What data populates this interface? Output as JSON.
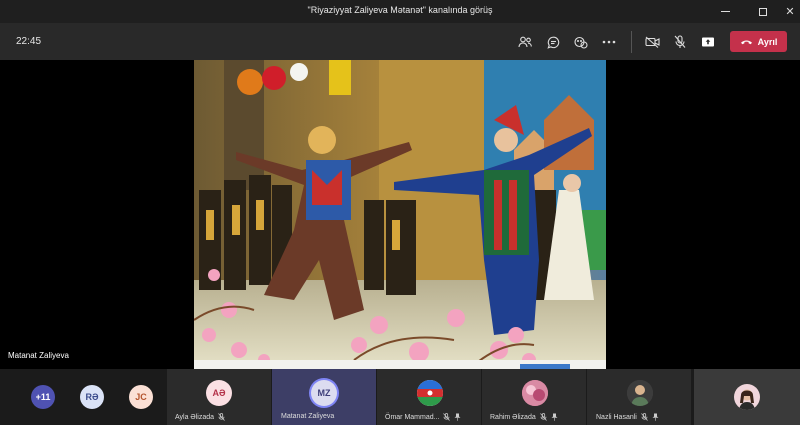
{
  "window": {
    "title": "\"Riyaziyyat Zaliyeva Mətanət\" kanalında görüş"
  },
  "toolbar": {
    "time": "22:45",
    "leave_label": "Ayrıl",
    "icons": [
      "participants-icon",
      "chat-icon",
      "reactions-icon",
      "more-icon",
      "camera-off-icon",
      "mic-off-icon",
      "share-icon",
      "phone-hangup-icon"
    ]
  },
  "stage": {
    "presenter_name": "Matanat Zaliyeva"
  },
  "strip": {
    "overflow_count": "+11",
    "small_avatars": [
      {
        "initials": "RƏ",
        "bg": "#dbe3f7",
        "fg": "#3b4b8c"
      },
      {
        "initials": "JC",
        "bg": "#fbe0d5",
        "fg": "#b4542d"
      }
    ],
    "tiles": [
      {
        "initials": "AƏ",
        "name": "Ayla Əlizada",
        "bg": "#fbe0e4",
        "fg": "#b4324a"
      },
      {
        "initials": "MZ",
        "name": "Matanat Zaliyeva",
        "bg": "#dcdcf0",
        "fg": "#3e3e7a"
      },
      {
        "name": "Ömar Mammad..."
      },
      {
        "name": "Rahim Əlizada"
      },
      {
        "name": "Nazli Hasanli"
      }
    ]
  },
  "colors": {
    "accent": "#6264a7",
    "leave": "#c4314b"
  }
}
